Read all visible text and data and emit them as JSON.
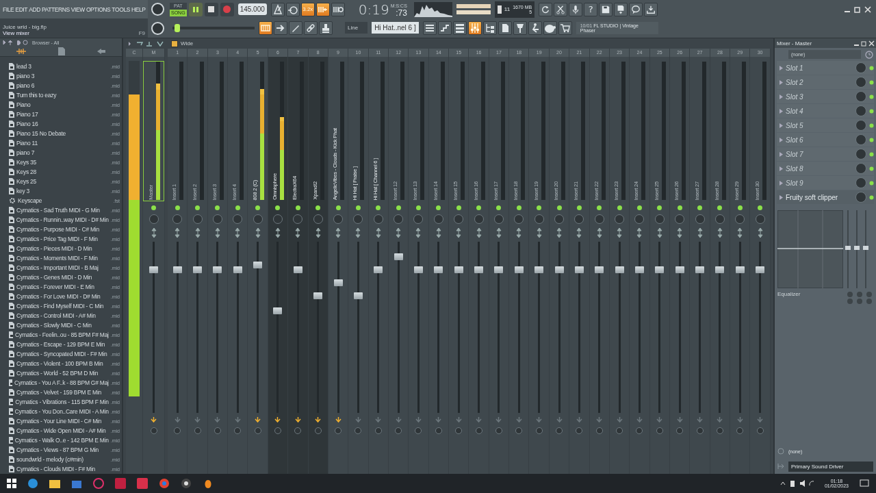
{
  "menu": [
    "FILE",
    "EDIT",
    "ADD",
    "PATTERNS",
    "VIEW",
    "OPTIONS",
    "TOOLS",
    "HELP"
  ],
  "hint": {
    "title": "Juice wrld - big.flp",
    "text": "View mixer",
    "key": "F9"
  },
  "transport": {
    "modes": [
      {
        "label": "PAT",
        "selected": false
      },
      {
        "label": "SONG",
        "selected": true
      }
    ],
    "playing": true,
    "tempo": "145.000"
  },
  "master_volume": {
    "level": 0.06
  },
  "tool_buttons": [
    {
      "on": false
    },
    {
      "on": false
    },
    {
      "on": true,
      "label": "3.2x"
    },
    {
      "on": true
    },
    {
      "on": false
    }
  ],
  "time": {
    "value": "0:19",
    "cs": ":73",
    "unit": "M:S:CS"
  },
  "system": {
    "voices": "11",
    "memory": "1670 MB",
    "cpu": "5"
  },
  "help_label": "?",
  "edit_buttons": [
    {
      "on": true
    },
    {
      "on": false
    },
    {
      "on": false
    },
    {
      "on": false
    },
    {
      "on": false
    }
  ],
  "snap": "Line",
  "pattern": "Hi Hat..nel 6 ]",
  "view_buttons": [
    {
      "on": false
    },
    {
      "on": false
    },
    {
      "on": false
    },
    {
      "on": true
    },
    {
      "on": false
    },
    {
      "on": false
    },
    {
      "on": false
    },
    {
      "on": false
    },
    {
      "on": false
    },
    {
      "on": false
    }
  ],
  "news": {
    "date": "10/01",
    "title": "FL STUDIO | Vintage",
    "text": "Phaser"
  },
  "browser": {
    "title": "Browser - All",
    "items": [
      {
        "name": "lead 3",
        "ext": ".mid",
        "kind": "file"
      },
      {
        "name": "piano 3",
        "ext": ".mid",
        "kind": "file"
      },
      {
        "name": "piano 6",
        "ext": ".mid",
        "kind": "file"
      },
      {
        "name": "Turn this to eazy",
        "ext": ".mid",
        "kind": "file"
      },
      {
        "name": "Piano",
        "ext": ".mid",
        "kind": "file"
      },
      {
        "name": "Piano 17",
        "ext": ".mid",
        "kind": "file"
      },
      {
        "name": "Piano 16",
        "ext": ".mid",
        "kind": "file"
      },
      {
        "name": "Piano 15 No Debate",
        "ext": ".mid",
        "kind": "file"
      },
      {
        "name": "Piano 11",
        "ext": ".mid",
        "kind": "file"
      },
      {
        "name": "piano 7",
        "ext": ".mid",
        "kind": "file"
      },
      {
        "name": "Keys 35",
        "ext": ".mid",
        "kind": "file"
      },
      {
        "name": "Keys 28",
        "ext": ".mid",
        "kind": "file"
      },
      {
        "name": "Keys 25",
        "ext": ".mid",
        "kind": "file"
      },
      {
        "name": "key 3",
        "ext": ".mid",
        "kind": "file"
      },
      {
        "name": "Keyscape",
        "ext": ".fst",
        "kind": "plugin"
      },
      {
        "name": "Cymatics - Sad Truth MIDI - G Min",
        "ext": ".mid",
        "kind": "file"
      },
      {
        "name": "Cymatics - Runnin..way MIDI - D# Min",
        "ext": ".mid",
        "kind": "file"
      },
      {
        "name": "Cymatics - Purpose MIDI - C# Min",
        "ext": ".mid",
        "kind": "file"
      },
      {
        "name": "Cymatics - Price Tag MIDI - F Min",
        "ext": ".mid",
        "kind": "file"
      },
      {
        "name": "Cymatics - Pieces MIDI - D Min",
        "ext": ".mid",
        "kind": "file"
      },
      {
        "name": "Cymatics - Moments MIDI - F Min",
        "ext": ".mid",
        "kind": "file"
      },
      {
        "name": "Cymatics - Important MIDI - B Maj",
        "ext": ".mid",
        "kind": "file"
      },
      {
        "name": "Cymatics - Genes MIDI - D Min",
        "ext": ".mid",
        "kind": "file"
      },
      {
        "name": "Cymatics - Forever MIDI - E Min",
        "ext": ".mid",
        "kind": "file"
      },
      {
        "name": "Cymatics - For Love MIDI - D# Min",
        "ext": ".mid",
        "kind": "file"
      },
      {
        "name": "Cymatics - Find Myself MIDI - C Min",
        "ext": ".mid",
        "kind": "file"
      },
      {
        "name": "Cymatics - Control MIDI - A# Min",
        "ext": ".mid",
        "kind": "file"
      },
      {
        "name": "Cymatics - Slowly MIDI - C Min",
        "ext": ".mid",
        "kind": "file"
      },
      {
        "name": "Cymatics - Feelin..ou - 85 BPM F# Maj",
        "ext": ".mid",
        "kind": "file"
      },
      {
        "name": "Cymatics - Escape - 129 BPM E Min",
        "ext": ".mid",
        "kind": "file"
      },
      {
        "name": "Cymatics - Syncopated MIDI - F# Min",
        "ext": ".mid",
        "kind": "file"
      },
      {
        "name": "Cymatics - Violent - 100 BPM B Min",
        "ext": ".mid",
        "kind": "file"
      },
      {
        "name": "Cymatics - World - 52 BPM D Min",
        "ext": ".mid",
        "kind": "file"
      },
      {
        "name": "Cymatics - You A F..k - 88 BPM G# Maj",
        "ext": ".mid",
        "kind": "file"
      },
      {
        "name": "Cymatics - Velvet - 159 BPM E Min",
        "ext": ".mid",
        "kind": "file"
      },
      {
        "name": "Cymatics - Vibrations - 115 BPM F Min",
        "ext": ".mid",
        "kind": "file"
      },
      {
        "name": "Cymatics - You Don..Care MIDI - A Min",
        "ext": ".mid",
        "kind": "file"
      },
      {
        "name": "Cymatics - Your Line MIDI - C# Min",
        "ext": ".mid",
        "kind": "file"
      },
      {
        "name": "Cymatics - Wide Open MIDI - A# Min",
        "ext": ".mid",
        "kind": "file"
      },
      {
        "name": "Cymatics - Walk O..e - 142 BPM E Min",
        "ext": ".mid",
        "kind": "file"
      },
      {
        "name": "Cymatics - Views - 87 BPM G Min",
        "ext": ".mid",
        "kind": "file"
      },
      {
        "name": "soundwrld - melody (c#min)",
        "ext": ".mid",
        "kind": "file"
      },
      {
        "name": "Cymatics - Clouds MIDI - F# Min",
        "ext": ".mid",
        "kind": "file"
      }
    ]
  },
  "mixer": {
    "mode": "Wide",
    "current": {
      "label": "C",
      "meter": {
        "level": 0.9
      }
    },
    "tracks": [
      {
        "number": "M",
        "label": "Master",
        "selected": true,
        "highlighted": false,
        "routed": true,
        "meter": {
          "level": 0.84
        },
        "fader": {
          "level": 0.85
        }
      },
      {
        "number": "1",
        "label": "Insert 1",
        "selected": false,
        "highlighted": false,
        "routed": false,
        "fader": {
          "level": 0.85
        }
      },
      {
        "number": "2",
        "label": "Insert 2",
        "selected": false,
        "highlighted": false,
        "routed": false,
        "fader": {
          "level": 0.85
        }
      },
      {
        "number": "3",
        "label": "Insert 3",
        "selected": false,
        "highlighted": false,
        "routed": false,
        "fader": {
          "level": 0.85
        }
      },
      {
        "number": "4",
        "label": "Insert 4",
        "selected": false,
        "highlighted": false,
        "routed": false,
        "fader": {
          "level": 0.85
        }
      },
      {
        "number": "5",
        "label": "808 2 (C)",
        "selected": false,
        "highlighted": false,
        "routed": true,
        "meter": {
          "level": 0.8
        },
        "fader": {
          "level": 0.88
        }
      },
      {
        "number": "6",
        "label": "Omnisphere",
        "selected": false,
        "highlighted": true,
        "routed": true,
        "meter": {
          "level": 0.6
        },
        "fader": {
          "level": 0.6
        }
      },
      {
        "number": "7",
        "label": "ElectraX64",
        "selected": false,
        "highlighted": true,
        "routed": true,
        "fader": {
          "level": 0.85
        }
      },
      {
        "number": "8",
        "label": "Xpand!2",
        "selected": false,
        "highlighted": true,
        "routed": true,
        "fader": {
          "level": 0.69
        }
      },
      {
        "number": "9",
        "label": "AngelicVibes - Clouds - Kick Phat",
        "selected": false,
        "highlighted": false,
        "routed": true,
        "fader": {
          "level": 0.77
        }
      },
      {
        "number": "10",
        "label": "Hi Hat [ Praise ]",
        "selected": false,
        "highlighted": false,
        "routed": false,
        "fader": {
          "level": 0.69
        }
      },
      {
        "number": "11",
        "label": "Hi Hat [ Channel 6 ]",
        "selected": false,
        "highlighted": false,
        "routed": false,
        "fader": {
          "level": 0.85
        }
      },
      {
        "number": "12",
        "label": "Insert 12",
        "selected": false,
        "highlighted": false,
        "routed": false,
        "fader": {
          "level": 0.93
        }
      },
      {
        "number": "13",
        "label": "Insert 13",
        "selected": false,
        "highlighted": false,
        "routed": false,
        "fader": {
          "level": 0.85
        }
      },
      {
        "number": "14",
        "label": "Insert 14",
        "selected": false,
        "highlighted": false,
        "routed": false,
        "fader": {
          "level": 0.85
        }
      },
      {
        "number": "15",
        "label": "Insert 15",
        "selected": false,
        "highlighted": false,
        "routed": false,
        "fader": {
          "level": 0.85
        }
      },
      {
        "number": "16",
        "label": "Insert 16",
        "selected": false,
        "highlighted": false,
        "routed": false,
        "fader": {
          "level": 0.85
        }
      },
      {
        "number": "17",
        "label": "Insert 17",
        "selected": false,
        "highlighted": false,
        "routed": false,
        "fader": {
          "level": 0.85
        }
      },
      {
        "number": "18",
        "label": "Insert 18",
        "selected": false,
        "highlighted": false,
        "routed": false,
        "fader": {
          "level": 0.85
        }
      },
      {
        "number": "19",
        "label": "Insert 19",
        "selected": false,
        "highlighted": false,
        "routed": false,
        "fader": {
          "level": 0.85
        }
      },
      {
        "number": "20",
        "label": "Insert 20",
        "selected": false,
        "highlighted": false,
        "routed": false,
        "fader": {
          "level": 0.85
        }
      },
      {
        "number": "21",
        "label": "Insert 21",
        "selected": false,
        "highlighted": false,
        "routed": false,
        "fader": {
          "level": 0.85
        }
      },
      {
        "number": "22",
        "label": "Insert 22",
        "selected": false,
        "highlighted": false,
        "routed": false,
        "fader": {
          "level": 0.85
        }
      },
      {
        "number": "23",
        "label": "Insert 23",
        "selected": false,
        "highlighted": false,
        "routed": false,
        "fader": {
          "level": 0.85
        }
      },
      {
        "number": "24",
        "label": "Insert 24",
        "selected": false,
        "highlighted": false,
        "routed": false,
        "fader": {
          "level": 0.85
        }
      },
      {
        "number": "25",
        "label": "Insert 25",
        "selected": false,
        "highlighted": false,
        "routed": false,
        "fader": {
          "level": 0.85
        }
      },
      {
        "number": "26",
        "label": "Insert 26",
        "selected": false,
        "highlighted": false,
        "routed": false,
        "fader": {
          "level": 0.85
        }
      },
      {
        "number": "27",
        "label": "Insert 27",
        "selected": false,
        "highlighted": false,
        "routed": false,
        "fader": {
          "level": 0.85
        }
      },
      {
        "number": "28",
        "label": "Insert 28",
        "selected": false,
        "highlighted": false,
        "routed": false,
        "fader": {
          "level": 0.85
        }
      },
      {
        "number": "29",
        "label": "Insert 29",
        "selected": false,
        "highlighted": false,
        "routed": false,
        "fader": {
          "level": 0.85
        }
      },
      {
        "number": "30",
        "label": "Insert 30",
        "selected": false,
        "highlighted": false,
        "routed": false,
        "fader": {
          "level": 0.85
        }
      }
    ]
  },
  "insert_panel": {
    "title": "Mixer - Master",
    "input": "(none)",
    "slots": [
      {
        "name": "Slot 1",
        "empty": true,
        "on": true
      },
      {
        "name": "Slot 2",
        "empty": true,
        "on": true
      },
      {
        "name": "Slot 3",
        "empty": true,
        "on": true
      },
      {
        "name": "Slot 4",
        "empty": true,
        "on": true
      },
      {
        "name": "Slot 5",
        "empty": true,
        "on": true
      },
      {
        "name": "Slot 6",
        "empty": true,
        "on": true
      },
      {
        "name": "Slot 7",
        "empty": true,
        "on": true
      },
      {
        "name": "Slot 8",
        "empty": true,
        "on": true
      },
      {
        "name": "Slot 9",
        "empty": true,
        "on": true
      },
      {
        "name": "Fruity soft clipper",
        "empty": false,
        "on": true
      }
    ],
    "eq_label": "Equalizer",
    "output_label": "(none)",
    "output": "Primary Sound Driver"
  },
  "clock": {
    "time": "01:18",
    "date": "01/02/2023"
  }
}
